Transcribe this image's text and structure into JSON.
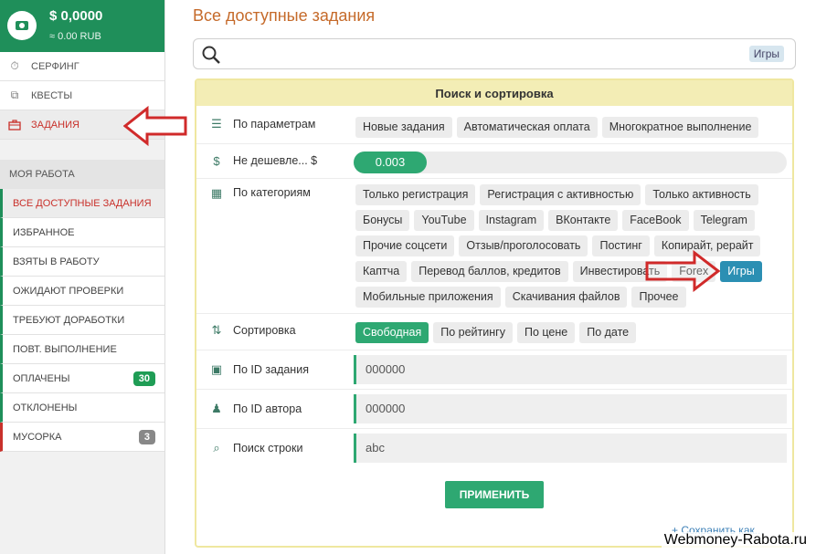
{
  "balance": {
    "usd": "$ 0,0000",
    "rub": "≈ 0.00 RUB",
    "icon": "wallet-icon"
  },
  "nav": [
    {
      "label": "СЕРФИНГ",
      "icon": "stopwatch-icon"
    },
    {
      "label": "КВЕСТЫ",
      "icon": "puzzle-icon"
    },
    {
      "label": "ЗАДАНИЯ",
      "icon": "briefcase-icon"
    }
  ],
  "my_work": {
    "title": "МОЯ РАБОТА",
    "items": [
      {
        "label": "ВСЕ ДОСТУПНЫЕ ЗАДАНИЯ",
        "count": ""
      },
      {
        "label": "ИЗБРАННОЕ",
        "count": ""
      },
      {
        "label": "ВЗЯТЫ В РАБОТУ",
        "count": ""
      },
      {
        "label": "ОЖИДАЮТ ПРОВЕРКИ",
        "count": ""
      },
      {
        "label": "ТРЕБУЮТ ДОРАБОТКИ",
        "count": ""
      },
      {
        "label": "ПОВТ. ВЫПОЛНЕНИЕ",
        "count": ""
      },
      {
        "label": "ОПЛАЧЕНЫ",
        "count": "30"
      },
      {
        "label": "ОТКЛОНЕНЫ",
        "count": ""
      },
      {
        "label": "МУСОРКА",
        "count": "3"
      }
    ]
  },
  "page_title": "Все доступные задания",
  "search": {
    "tag": "Игры"
  },
  "panel": {
    "title": "Поиск и сортировка",
    "params": {
      "label": "По параметрам",
      "chips": [
        "Новые задания",
        "Автоматическая оплата",
        "Многократное выполнение"
      ]
    },
    "price": {
      "label": "Не дешевле... $",
      "value": "0.003"
    },
    "categories": {
      "label": "По категориям",
      "chips": [
        "Только регистрация",
        "Регистрация с активностью",
        "Только активность",
        "Бонусы",
        "YouTube",
        "Instagram",
        "ВКонтакте",
        "FaceBook",
        "Telegram",
        "Прочие соцсети",
        "Отзыв/проголосовать",
        "Постинг",
        "Копирайт, рерайт",
        "Каптча",
        "Перевод баллов, кредитов",
        "Инвестировать",
        "Forex",
        "Игры",
        "Мобильные приложения",
        "Скачивания файлов",
        "Прочее"
      ],
      "selected": "Игры"
    },
    "sort": {
      "label": "Сортировка",
      "options": [
        "Свободная",
        "По рейтингу",
        "По цене",
        "По дате"
      ],
      "selected": "Свободная"
    },
    "task_id": {
      "label": "По ID задания",
      "value": "000000"
    },
    "author_id": {
      "label": "По ID автора",
      "value": "000000"
    },
    "search_string": {
      "label": "Поиск строки",
      "value": "abc"
    },
    "apply": "ПРИМЕНИТЬ",
    "save": "+ Сохранить как..."
  },
  "watermark": "Webmoney-Rabota.ru",
  "colors": {
    "green": "#1f8f5a",
    "accent_red": "#c9312b",
    "title_orange": "#c56a2a",
    "selected_blue": "#2b8fb3"
  }
}
